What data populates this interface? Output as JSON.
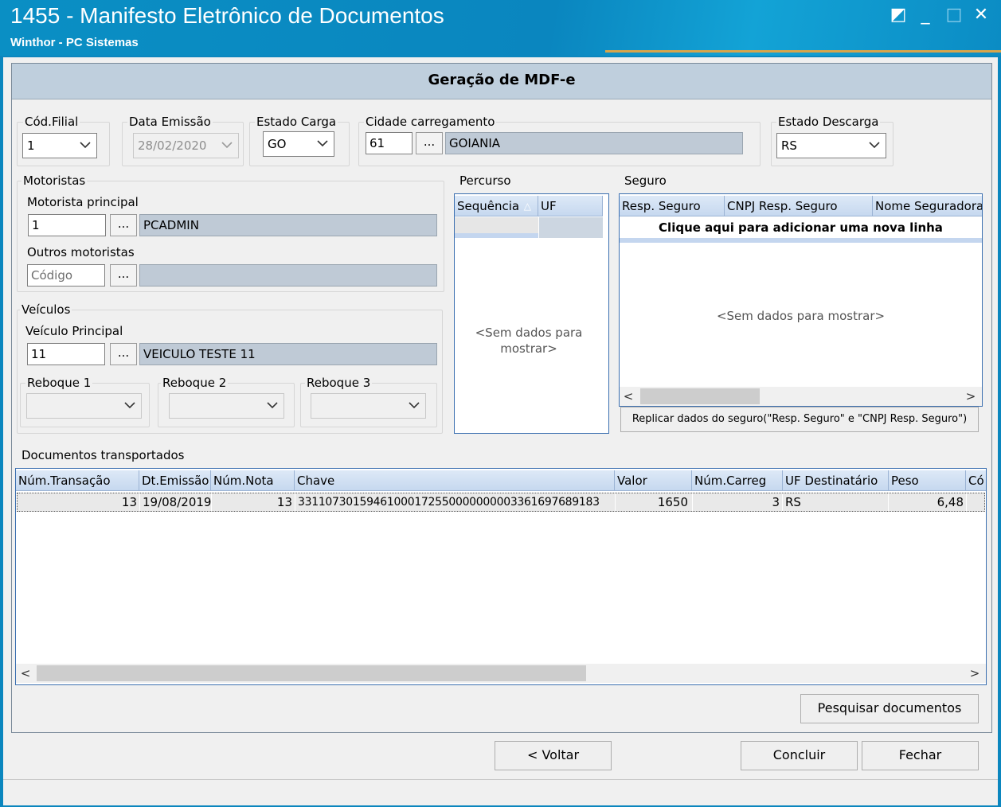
{
  "window": {
    "title": "1455 - Manifesto Eletrônico de Documentos",
    "subtitle": "Winthor - PC Sistemas",
    "controls": {
      "minimize": "_",
      "maximize": "□",
      "close": "✕",
      "extra": "◩"
    }
  },
  "form": {
    "heading": "Geração de MDF-e",
    "cod_filial": {
      "label": "Cód.Filial",
      "value": "1"
    },
    "data_emissao": {
      "label": "Data Emissão",
      "value": "28/02/2020"
    },
    "estado_carga": {
      "label": "Estado Carga",
      "value": "GO"
    },
    "cidade": {
      "label": "Cidade carregamento",
      "code": "61",
      "dots": "...",
      "name": "GOIANIA"
    },
    "estado_descarga": {
      "label": "Estado Descarga",
      "value": "RS"
    }
  },
  "motoristas": {
    "group_label": "Motoristas",
    "principal_label": "Motorista principal",
    "principal_code": "1",
    "principal_name": "PCADMIN",
    "outros_label": "Outros motoristas",
    "outros_placeholder": "Código",
    "outros_name": "",
    "dots": "..."
  },
  "veiculos": {
    "group_label": "Veículos",
    "principal_label": "Veículo Principal",
    "principal_code": "11",
    "principal_name": "VEICULO TESTE 11",
    "dots": "...",
    "reboque1_label": "Reboque 1",
    "reboque2_label": "Reboque 2",
    "reboque3_label": "Reboque 3"
  },
  "percurso": {
    "group_label": "Percurso",
    "columns": [
      "Sequência",
      "UF"
    ],
    "sort_indicator": "△",
    "empty": "<Sem dados para mostrar>"
  },
  "seguro": {
    "group_label": "Seguro",
    "columns": [
      "Resp. Seguro",
      "CNPJ Resp. Seguro",
      "Nome Seguradora"
    ],
    "new_row": "Clique aqui para adicionar uma nova linha",
    "empty": "<Sem dados para mostrar>",
    "replicar_button": "Replicar dados do seguro(\"Resp. Seguro\" e \"CNPJ Resp. Seguro\")"
  },
  "documentos": {
    "group_label": "Documentos transportados",
    "columns": [
      "Núm.Transação",
      "Dt.Emissão",
      "Núm.Nota",
      "Chave",
      "Valor",
      "Núm.Carreg",
      "UF Destinatário",
      "Peso",
      "Có"
    ],
    "rows": [
      [
        "13",
        "19/08/2019",
        "13",
        "33110730159461000172550000000003361697689183",
        "1650",
        "3",
        "RS",
        "6,48",
        ""
      ]
    ],
    "pesquisar_button": "Pesquisar documentos"
  },
  "footer": {
    "voltar": "< Voltar",
    "concluir": "Concluir",
    "fechar": "Fechar"
  },
  "scroll": {
    "left": "<",
    "right": ">"
  },
  "colors": {
    "titlebar": "#0a8fc4",
    "header": "#bfcfdd",
    "grid_border": "#3b6fb0"
  }
}
